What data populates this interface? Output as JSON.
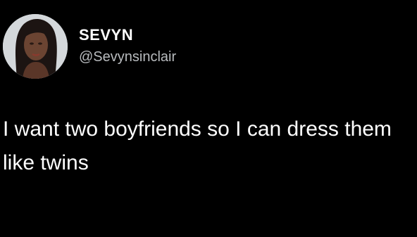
{
  "tweet": {
    "author": {
      "display_name": "SEVYN",
      "handle": "@Sevynsinclair",
      "avatar_icon": "profile-photo"
    },
    "text": "I want two boyfriends so I can dress them like twins"
  },
  "colors": {
    "background": "#000000",
    "name": "#ffffff",
    "handle": "#b8bbbe",
    "text": "#ffffff"
  }
}
